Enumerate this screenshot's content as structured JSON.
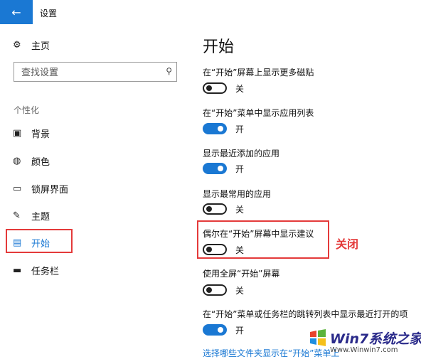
{
  "window": {
    "title": "设置"
  },
  "sidebar": {
    "home": "主页",
    "search_placeholder": "查找设置",
    "section": "个性化",
    "items": [
      {
        "label": "背景",
        "icon": "image-icon"
      },
      {
        "label": "颜色",
        "icon": "palette-icon"
      },
      {
        "label": "锁屏界面",
        "icon": "lock-screen-icon"
      },
      {
        "label": "主题",
        "icon": "brush-icon"
      },
      {
        "label": "开始",
        "icon": "start-icon",
        "selected": true
      },
      {
        "label": "任务栏",
        "icon": "taskbar-icon"
      }
    ]
  },
  "main": {
    "title": "开始",
    "settings": [
      {
        "label": "在“开始”屏幕上显示更多磁贴",
        "on": false,
        "state": "关"
      },
      {
        "label": "在“开始”菜单中显示应用列表",
        "on": true,
        "state": "开"
      },
      {
        "label": "显示最近添加的应用",
        "on": true,
        "state": "开"
      },
      {
        "label": "显示最常用的应用",
        "on": false,
        "state": "关"
      },
      {
        "label": "偶尔在“开始”屏幕中显示建议",
        "on": false,
        "state": "关"
      },
      {
        "label": "使用全屏“开始”屏幕",
        "on": false,
        "state": "关"
      },
      {
        "label": "在“开始”菜单或任务栏的跳转列表中显示最近打开的项",
        "on": true,
        "state": "开"
      }
    ],
    "link": "选择哪些文件夹显示在“开始”菜单上"
  },
  "annotation": {
    "text": "关闭",
    "color": "#e43a3a"
  },
  "watermark": {
    "brand": "Win7系统之家",
    "url": "Www.Winwin7.com"
  },
  "colors": {
    "accent": "#1a78d3",
    "annotation": "#e43a3a"
  }
}
